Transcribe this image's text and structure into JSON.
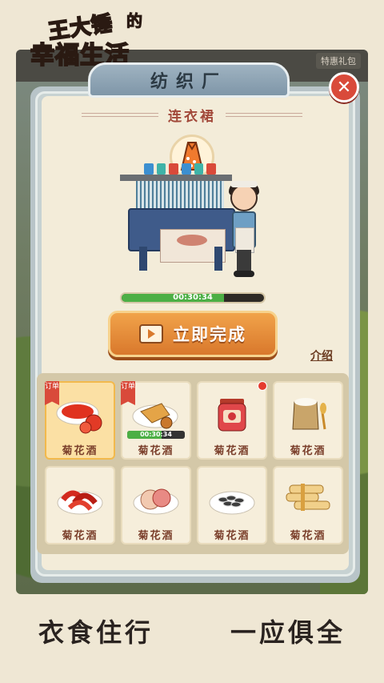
{
  "logo": {
    "line1": "王大锤",
    "de": "的",
    "line2_a": "幸福",
    "line2_b": "生活"
  },
  "top_tag": "特惠礼包",
  "panel": {
    "title": "纺织厂",
    "close_symbol": "✕",
    "item_name": "连衣裙",
    "progress": {
      "time": "00:30:34",
      "fraction": 0.72
    },
    "finish_button": "立即完成",
    "intro_link": "介绍"
  },
  "grid": {
    "items": [
      {
        "label": "菊花酒",
        "icon": "tomato-sauce-icon",
        "order": "订单",
        "selected": true
      },
      {
        "label": "菊花酒",
        "icon": "fried-chicken-icon",
        "order": "订单",
        "timer": "00:30:34",
        "fraction": 0.6
      },
      {
        "label": "菊花酒",
        "icon": "jam-jar-icon",
        "red_dot": true
      },
      {
        "label": "菊花酒",
        "icon": "flour-sack-icon"
      },
      {
        "label": "菊花酒",
        "icon": "chili-peppers-icon"
      },
      {
        "label": "菊花酒",
        "icon": "bun-plate-icon"
      },
      {
        "label": "菊花酒",
        "icon": "sunflower-seeds-icon"
      },
      {
        "label": "菊花酒",
        "icon": "noodle-bundles-icon"
      }
    ]
  },
  "slogan": {
    "left": "衣食住行",
    "right": "一应俱全"
  },
  "colors": {
    "accent_orange": "#d9782c",
    "progress_green": "#4caf45",
    "close_red": "#d94a3a",
    "label_brown": "#7a3e2a"
  }
}
